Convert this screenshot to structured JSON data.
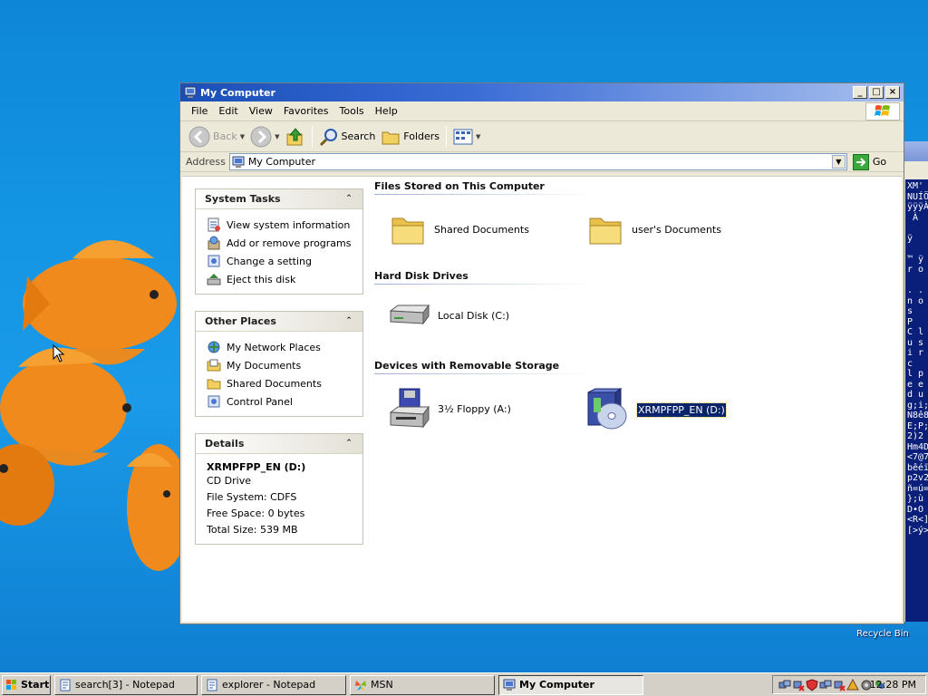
{
  "desktop": {
    "recycle_bin_label": "Recycle Bin",
    "background_text_lines": [
      "XM'",
      "NUÍÖ",
      "ÿÿÿÀ",
      " À",
      "",
      "ÿ",
      "",
      "™ ÿ",
      "r o",
      "",
      ". .",
      "n o",
      "s",
      "P",
      "C l",
      "u s",
      "i r",
      "c",
      "l p",
      "e e",
      "d u",
      "g;i;",
      "N8ê8",
      "E;P;",
      "2)2",
      "Hm4D",
      "<7@7",
      "bêéï",
      "p2v2",
      "ñ=ú=",
      "};ù",
      "D•O",
      "<R<]",
      "[>ý>"
    ]
  },
  "window": {
    "title": "My Computer",
    "menu": [
      "File",
      "Edit",
      "View",
      "Favorites",
      "Tools",
      "Help"
    ],
    "toolbar": {
      "back_label": "Back",
      "search_label": "Search",
      "folders_label": "Folders"
    },
    "address": {
      "label": "Address",
      "value": "My Computer",
      "go_label": "Go"
    },
    "system_tasks": {
      "title": "System Tasks",
      "items": [
        {
          "label": "View system information",
          "icon": "system-info-icon"
        },
        {
          "label": "Add or remove programs",
          "icon": "add-remove-programs-icon"
        },
        {
          "label": "Change a setting",
          "icon": "control-panel-icon"
        },
        {
          "label": "Eject this disk",
          "icon": "eject-icon"
        }
      ]
    },
    "other_places": {
      "title": "Other Places",
      "items": [
        {
          "label": "My Network Places",
          "icon": "network-places-icon"
        },
        {
          "label": "My Documents",
          "icon": "my-documents-icon"
        },
        {
          "label": "Shared Documents",
          "icon": "folder-icon"
        },
        {
          "label": "Control Panel",
          "icon": "control-panel-icon"
        }
      ]
    },
    "details": {
      "title": "Details",
      "name": "XRMPFPP_EN (D:)",
      "type": "CD Drive",
      "file_system": "File System: CDFS",
      "free_space": "Free Space: 0 bytes",
      "total_size": "Total Size: 539 MB"
    },
    "groups": {
      "files_stored": {
        "title": "Files Stored on This Computer",
        "items": [
          "Shared Documents",
          "user's Documents"
        ]
      },
      "hard_disks": {
        "title": "Hard Disk Drives",
        "items": [
          "Local Disk (C:)"
        ]
      },
      "removable": {
        "title": "Devices with Removable Storage",
        "items": [
          "3½ Floppy (A:)",
          "XRMPFPP_EN (D:)"
        ]
      }
    }
  },
  "taskbar": {
    "start_label": "Start",
    "buttons": [
      {
        "label": "search[3] - Notepad",
        "active": false
      },
      {
        "label": "explorer - Notepad",
        "active": false
      },
      {
        "label": "MSN",
        "active": false
      },
      {
        "label": "My Computer",
        "active": true
      }
    ],
    "clock": "12:28 PM"
  },
  "colors": {
    "titlebar_start": "#1a4fb8",
    "selection": "#0a246a",
    "desktop": "#1496e4"
  }
}
